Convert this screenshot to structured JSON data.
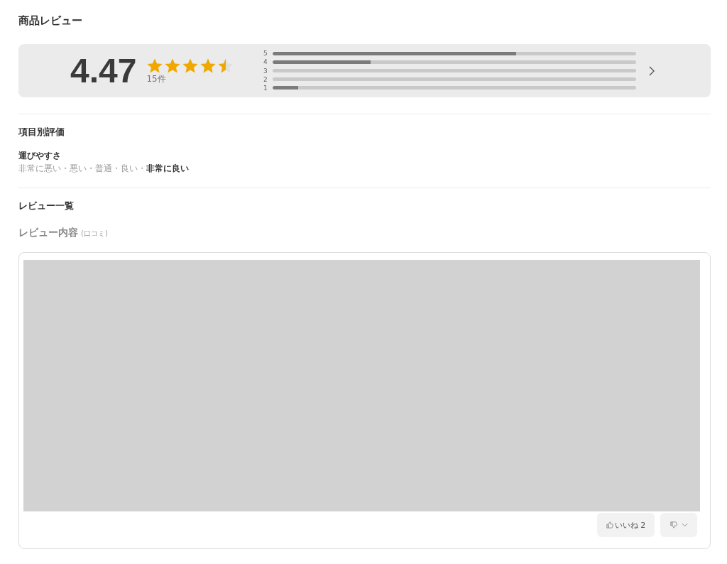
{
  "title": "商品レビュー",
  "summary": {
    "score": "4.47",
    "stars": 4.5,
    "count": "15件",
    "distribution": [
      {
        "label": "5",
        "level": 0.67
      },
      {
        "label": "4",
        "level": 0.27
      },
      {
        "label": "3"
      },
      {
        "label": "2"
      },
      {
        "label": "1",
        "level": 0.07
      }
    ]
  },
  "criteria": {
    "heading": "項目別評価",
    "items": [
      {
        "name": "運びやすさ",
        "separator": "・",
        "scale": [
          {
            "label": "非常に悪い",
            "selected": false
          },
          {
            "label": "悪い",
            "selected": false
          },
          {
            "label": "普通",
            "selected": false
          },
          {
            "label": "良い",
            "selected": false
          },
          {
            "label": "非常に良い",
            "selected": true
          }
        ]
      }
    ]
  },
  "reviews": {
    "heading": "レビュー一覧",
    "subheading": "レビュー内容",
    "subheading_note": "(口コミ)",
    "items": [
      {
        "like_button": "いいね 2"
      }
    ]
  }
}
